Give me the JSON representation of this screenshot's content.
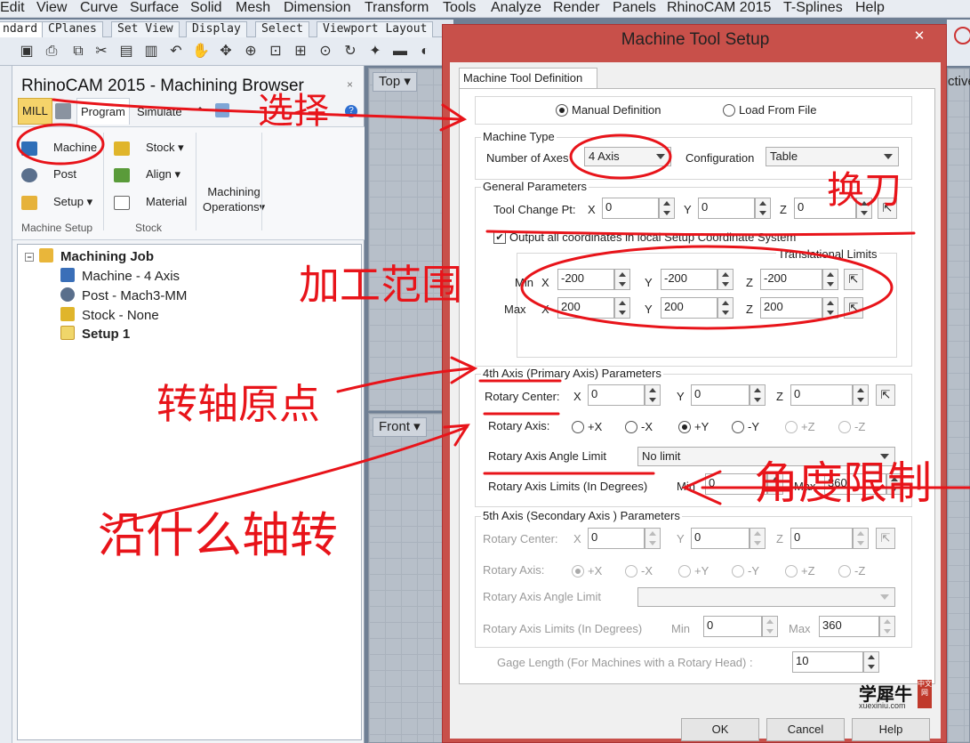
{
  "menubar": [
    "Edit",
    "View",
    "Curve",
    "Surface",
    "Solid",
    "Mesh",
    "Dimension",
    "Transform",
    "Tools",
    "Analyze",
    "Render",
    "Panels",
    "RhinoCAM 2015",
    "T-Splines",
    "Help"
  ],
  "rhino_tabs": [
    "ndard",
    "CPlanes",
    "Set View",
    "Display",
    "Select",
    "Viewport Layout"
  ],
  "panel": {
    "title": "RhinoCAM 2015 - Machining Browser",
    "close": "×",
    "tabs": [
      "MILL",
      "Program",
      "Simulate"
    ],
    "ribbon": {
      "machine": "Machine",
      "post": "Post",
      "setup": "Setup",
      "stock": "Stock",
      "align": "Align",
      "material": "Material",
      "ops": "Machining",
      "ops2": "Operations",
      "group_machine_setup": "Machine Setup",
      "group_stock": "Stock"
    },
    "tree": {
      "root": "Machining Job",
      "machine": "Machine - 4 Axis",
      "post": "Post - Mach3-MM",
      "stock": "Stock - None",
      "setup": "Setup 1"
    }
  },
  "viewports": {
    "top": "Top",
    "front": "Front",
    "right_partial": "ctive"
  },
  "dialog": {
    "title": "Machine Tool Setup",
    "close": "✕",
    "tab": "Machine Tool Definition",
    "manual": "Manual Definition",
    "load": "Load From File",
    "machine_type_title": "Machine Type",
    "num_axes_label": "Number of Axes",
    "num_axes_value": "4 Axis",
    "config_label": "Configuration",
    "config_value": "Table",
    "general_title": "General Parameters",
    "tool_change_label": "Tool Change Pt:",
    "tc": {
      "x": "0",
      "y": "0",
      "z": "0"
    },
    "output_local": "Output all coordinates in local Setup Coordinate System",
    "trans_limits": "Translational Limits",
    "min_label": "Min",
    "max_label": "Max",
    "min": {
      "x": "-200",
      "y": "-200",
      "z": "-200"
    },
    "max": {
      "x": "200",
      "y": "200",
      "z": "200"
    },
    "ax4_title": "4th Axis (Primary Axis) Parameters",
    "rotary_center": "Rotary Center:",
    "rc4": {
      "x": "0",
      "y": "0",
      "z": "0"
    },
    "rotary_axis": "Rotary Axis:",
    "axes": [
      "+X",
      "-X",
      "+Y",
      "-Y",
      "+Z",
      "-Z"
    ],
    "angle_limit": "Rotary Axis Angle Limit",
    "angle_limit_value": "No limit",
    "limits_deg": "Rotary Axis Limits (In Degrees)",
    "min_word": "Min",
    "max_word": "Max",
    "lim4": {
      "min": "0",
      "max": "360"
    },
    "ax5_title": "5th Axis (Secondary Axis ) Parameters",
    "rc5": {
      "x": "0",
      "y": "0",
      "z": "0"
    },
    "lim5": {
      "min": "0",
      "max": "360"
    },
    "gage": "Gage Length (For Machines with a Rotary Head) :",
    "gage_value": "10",
    "ok": "OK",
    "cancel": "Cancel",
    "help": "Help",
    "x": "X",
    "y": "Y",
    "z": "Z"
  },
  "annotations": [
    "选择",
    "加工范围",
    "转轴原点",
    "沿什么轴转",
    "角度限制",
    "换刀"
  ],
  "watermark": {
    "text": "学犀牛",
    "side": "中文网",
    "url": "xuexiniu.com"
  }
}
